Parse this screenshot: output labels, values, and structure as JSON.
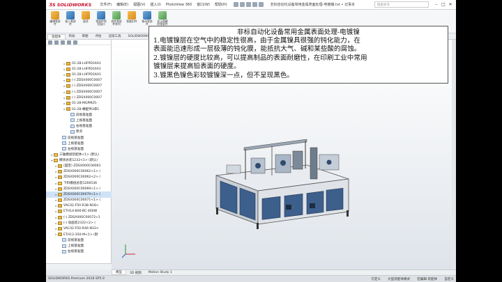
{
  "app": {
    "brand": "SOLIDWORKS",
    "document_title": "非标自动化设备常用金属表面处理-电镀镍.txt • 记事本"
  },
  "menu": [
    "文件(F)",
    "编辑(E)",
    "视图(V)",
    "插入(I)",
    "PhotoView 360",
    "窗口(W)",
    "帮助(H)"
  ],
  "search": {
    "placeholder": "搜索命令"
  },
  "ribbon": {
    "buttons": [
      {
        "label": "编辑零部件",
        "color": "orange"
      },
      {
        "label": "插入零部件",
        "color": "blue"
      },
      {
        "label": "配合",
        "color": "orange"
      },
      {
        "label": "零部件预览窗口",
        "color": "blue"
      },
      {
        "label": "线性零部件阵列",
        "color": "green"
      },
      {
        "label": "智能扣件",
        "color": "orange"
      },
      {
        "label": "移动零部件",
        "color": "blue"
      },
      {
        "label": "显示隐藏的零部件",
        "color": "green"
      }
    ]
  },
  "tabs": [
    "装配体",
    "布局",
    "草图",
    "评估",
    "渲染工具",
    "SOLIDWORKS 插件"
  ],
  "tree": {
    "items": [
      {
        "label": "01-28-LHFPD16A1",
        "indent": 4,
        "icon": "part",
        "expander": "▸"
      },
      {
        "label": "01-28-LHFPD16A1",
        "indent": 4,
        "icon": "part",
        "expander": "▸"
      },
      {
        "label": "01-28-LHFPD16A1",
        "indent": 4,
        "icon": "part",
        "expander": "▸"
      },
      {
        "label": "(-) ZDSX000C0007",
        "indent": 4,
        "icon": "part",
        "expander": "▸"
      },
      {
        "label": "(-) ZDSX000C0007",
        "indent": 4,
        "icon": "part",
        "expander": "▸"
      },
      {
        "label": "(-) ZDSX000C0007",
        "indent": 4,
        "icon": "part",
        "expander": "▸"
      },
      {
        "label": "(-) ZDSX000C0007",
        "indent": 4,
        "icon": "part",
        "expander": "▸"
      },
      {
        "label": "01-28-MGPM25-",
        "indent": 4,
        "icon": "part",
        "expander": "▸"
      },
      {
        "label": "01-28-横配件3单1",
        "indent": 4,
        "icon": "part",
        "expander": "▸"
      },
      {
        "label": "前视基准面",
        "indent": 5,
        "icon": "plane",
        "expander": ""
      },
      {
        "label": "上视基准面",
        "indent": 5,
        "icon": "plane",
        "expander": ""
      },
      {
        "label": "右视基准面",
        "indent": 5,
        "icon": "plane",
        "expander": ""
      },
      {
        "label": "原点",
        "indent": 5,
        "icon": "plane",
        "expander": ""
      },
      {
        "label": "前视基准面",
        "indent": 3,
        "icon": "plane",
        "expander": ""
      },
      {
        "label": "上视基准面",
        "indent": 3,
        "icon": "plane",
        "expander": ""
      },
      {
        "label": "右视基准面",
        "indent": 3,
        "icon": "plane",
        "expander": ""
      },
      {
        "label": "三轴模组装配体<1> (默认)",
        "indent": 1,
        "icon": "asm",
        "expander": "▸"
      },
      {
        "label": "模块总装1232<1> (默认)",
        "indent": 1,
        "icon": "asm",
        "expander": "▾"
      },
      {
        "label": "(固定) ZDSX000C00061",
        "indent": 2,
        "icon": "part",
        "expander": "▸"
      },
      {
        "label": "ZDSX000C00062<1> (",
        "indent": 2,
        "icon": "part",
        "expander": "▸"
      },
      {
        "label": "ZDSX000C00062<2> (",
        "indent": 2,
        "icon": "part",
        "expander": "▸"
      },
      {
        "label": "下料模组总装1266536",
        "indent": 2,
        "icon": "asm",
        "expander": "▸"
      },
      {
        "label": "ZDSX000C00069<1> (",
        "indent": 2,
        "icon": "part",
        "expander": "▸"
      },
      {
        "label": "ZDSX000C00070<1> (",
        "indent": 2,
        "icon": "part",
        "expander": "▸",
        "selected": true
      },
      {
        "label": "ZDSX000C00071<1> (",
        "indent": 2,
        "icon": "part",
        "expander": "▸"
      },
      {
        "label": "VAC42-F50-R38-N18<",
        "indent": 2,
        "icon": "part",
        "expander": "▸"
      },
      {
        "label": "ETH14-800-BC-400W",
        "indent": 2,
        "icon": "part",
        "expander": "▸"
      },
      {
        "label": "(-) ZDSX000C00072<1",
        "indent": 2,
        "icon": "part",
        "expander": "▸"
      },
      {
        "label": "(-) 动画装2322<2> (",
        "indent": 2,
        "icon": "part",
        "expander": "▸"
      },
      {
        "label": "VAC42-F50-R46-N33<",
        "indent": 2,
        "icon": "part",
        "expander": "▸"
      },
      {
        "label": "ETH12-350-M<1> (默",
        "indent": 2,
        "icon": "part",
        "expander": "▸"
      },
      {
        "label": "前视基准面",
        "indent": 3,
        "icon": "plane",
        "expander": ""
      },
      {
        "label": "上视基准面",
        "indent": 3,
        "icon": "plane",
        "expander": ""
      },
      {
        "label": "右视基准面",
        "indent": 3,
        "icon": "plane",
        "expander": ""
      }
    ]
  },
  "note": {
    "title": "非标自动化设备常用金属表面处理-电镀镍",
    "lines": [
      "1.电镀镍层在空气中的稳定性很高，由于金属镍具很强的钝化能力，在",
      "表面能迅速形成一层极薄的钝化膜，能抵抗大气、碱和某些酸的腐蚀。",
      "2.镀镍层的硬度比较高，可以提高制品的表面耐磨性，在印刷工业中常用",
      "镀镍层来提高铅表面的硬度。",
      "3.镀黑色镍色彩较镀镍深一点，但不呈现黑色。"
    ]
  },
  "bottom_tabs": [
    "模型",
    "3D 视图",
    "Motion Study 1"
  ],
  "status": {
    "left": "SOLIDWORKS Premium 2018 SP5.0",
    "items": [
      "欠定义",
      "大型装配体模式",
      "在编辑 装配体",
      "自定义"
    ]
  },
  "colors": {
    "accent": "#c8102e",
    "selection": "#cfe3f7",
    "machine_blue": "#3d5f8c"
  }
}
